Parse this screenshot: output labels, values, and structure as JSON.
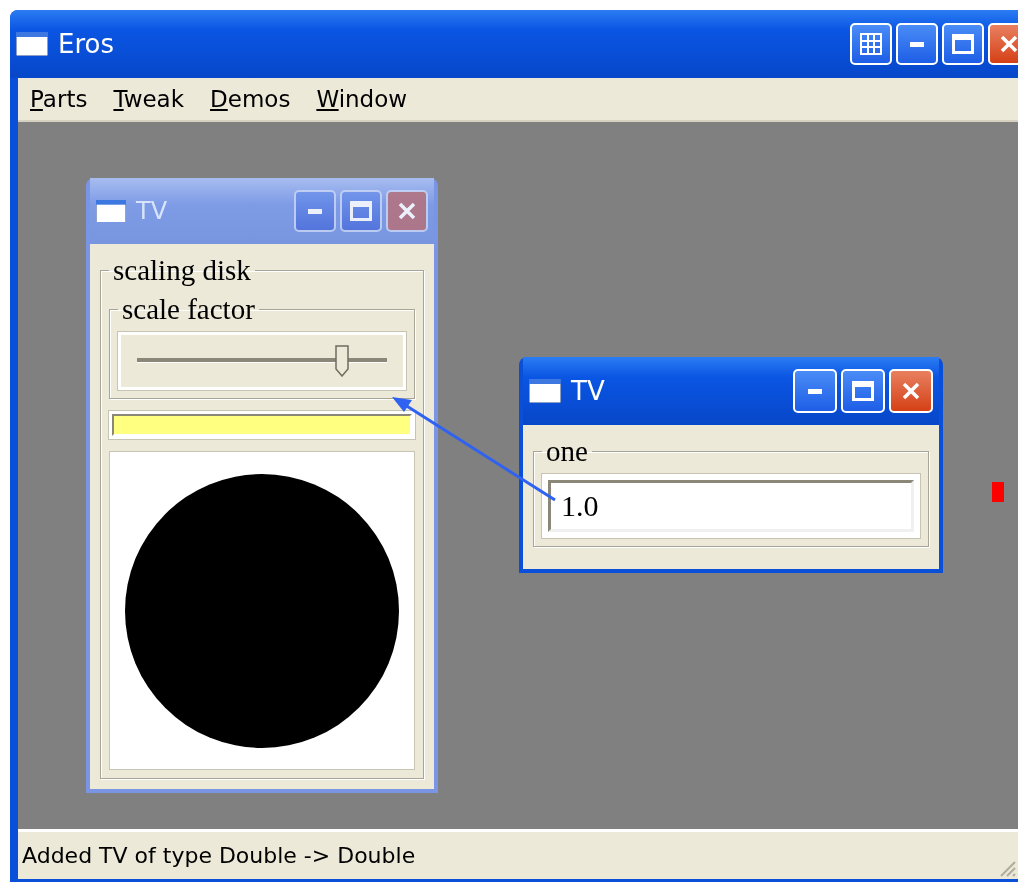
{
  "window": {
    "title": "Eros"
  },
  "menu": [
    {
      "label": "Parts"
    },
    {
      "label": "Tweak"
    },
    {
      "label": "Demos"
    },
    {
      "label": "Window"
    }
  ],
  "disk_window": {
    "title": "TV",
    "active": false,
    "group_label": "scaling disk",
    "slider_label": "scale factor",
    "slider": {
      "level": 0.82
    }
  },
  "value_window": {
    "title": "TV",
    "active": true,
    "group_label": "one",
    "field": {
      "value": "1.0"
    }
  },
  "status_bar": {
    "text": "Added TV of type Double -> Double"
  }
}
